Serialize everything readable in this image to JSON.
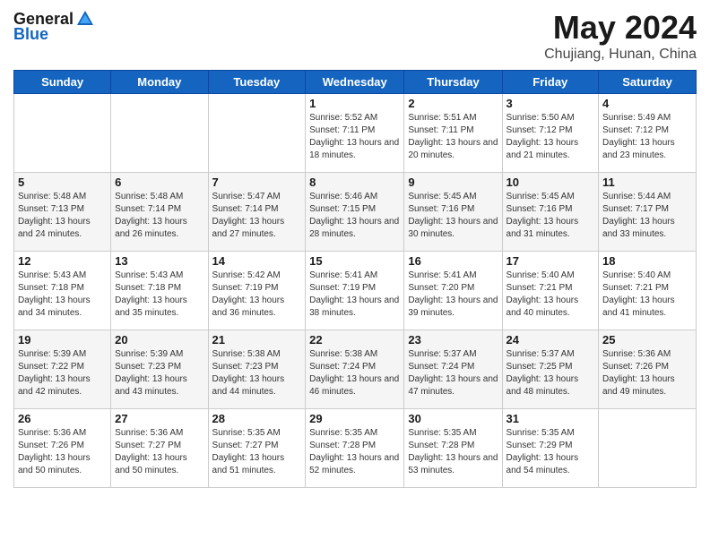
{
  "logo": {
    "general": "General",
    "blue": "Blue"
  },
  "title": {
    "month": "May 2024",
    "location": "Chujiang, Hunan, China"
  },
  "weekdays": [
    "Sunday",
    "Monday",
    "Tuesday",
    "Wednesday",
    "Thursday",
    "Friday",
    "Saturday"
  ],
  "weeks": [
    [
      {
        "day": "",
        "sunrise": "",
        "sunset": "",
        "daylight": ""
      },
      {
        "day": "",
        "sunrise": "",
        "sunset": "",
        "daylight": ""
      },
      {
        "day": "",
        "sunrise": "",
        "sunset": "",
        "daylight": ""
      },
      {
        "day": "1",
        "sunrise": "Sunrise: 5:52 AM",
        "sunset": "Sunset: 7:11 PM",
        "daylight": "Daylight: 13 hours and 18 minutes."
      },
      {
        "day": "2",
        "sunrise": "Sunrise: 5:51 AM",
        "sunset": "Sunset: 7:11 PM",
        "daylight": "Daylight: 13 hours and 20 minutes."
      },
      {
        "day": "3",
        "sunrise": "Sunrise: 5:50 AM",
        "sunset": "Sunset: 7:12 PM",
        "daylight": "Daylight: 13 hours and 21 minutes."
      },
      {
        "day": "4",
        "sunrise": "Sunrise: 5:49 AM",
        "sunset": "Sunset: 7:12 PM",
        "daylight": "Daylight: 13 hours and 23 minutes."
      }
    ],
    [
      {
        "day": "5",
        "sunrise": "Sunrise: 5:48 AM",
        "sunset": "Sunset: 7:13 PM",
        "daylight": "Daylight: 13 hours and 24 minutes."
      },
      {
        "day": "6",
        "sunrise": "Sunrise: 5:48 AM",
        "sunset": "Sunset: 7:14 PM",
        "daylight": "Daylight: 13 hours and 26 minutes."
      },
      {
        "day": "7",
        "sunrise": "Sunrise: 5:47 AM",
        "sunset": "Sunset: 7:14 PM",
        "daylight": "Daylight: 13 hours and 27 minutes."
      },
      {
        "day": "8",
        "sunrise": "Sunrise: 5:46 AM",
        "sunset": "Sunset: 7:15 PM",
        "daylight": "Daylight: 13 hours and 28 minutes."
      },
      {
        "day": "9",
        "sunrise": "Sunrise: 5:45 AM",
        "sunset": "Sunset: 7:16 PM",
        "daylight": "Daylight: 13 hours and 30 minutes."
      },
      {
        "day": "10",
        "sunrise": "Sunrise: 5:45 AM",
        "sunset": "Sunset: 7:16 PM",
        "daylight": "Daylight: 13 hours and 31 minutes."
      },
      {
        "day": "11",
        "sunrise": "Sunrise: 5:44 AM",
        "sunset": "Sunset: 7:17 PM",
        "daylight": "Daylight: 13 hours and 33 minutes."
      }
    ],
    [
      {
        "day": "12",
        "sunrise": "Sunrise: 5:43 AM",
        "sunset": "Sunset: 7:18 PM",
        "daylight": "Daylight: 13 hours and 34 minutes."
      },
      {
        "day": "13",
        "sunrise": "Sunrise: 5:43 AM",
        "sunset": "Sunset: 7:18 PM",
        "daylight": "Daylight: 13 hours and 35 minutes."
      },
      {
        "day": "14",
        "sunrise": "Sunrise: 5:42 AM",
        "sunset": "Sunset: 7:19 PM",
        "daylight": "Daylight: 13 hours and 36 minutes."
      },
      {
        "day": "15",
        "sunrise": "Sunrise: 5:41 AM",
        "sunset": "Sunset: 7:19 PM",
        "daylight": "Daylight: 13 hours and 38 minutes."
      },
      {
        "day": "16",
        "sunrise": "Sunrise: 5:41 AM",
        "sunset": "Sunset: 7:20 PM",
        "daylight": "Daylight: 13 hours and 39 minutes."
      },
      {
        "day": "17",
        "sunrise": "Sunrise: 5:40 AM",
        "sunset": "Sunset: 7:21 PM",
        "daylight": "Daylight: 13 hours and 40 minutes."
      },
      {
        "day": "18",
        "sunrise": "Sunrise: 5:40 AM",
        "sunset": "Sunset: 7:21 PM",
        "daylight": "Daylight: 13 hours and 41 minutes."
      }
    ],
    [
      {
        "day": "19",
        "sunrise": "Sunrise: 5:39 AM",
        "sunset": "Sunset: 7:22 PM",
        "daylight": "Daylight: 13 hours and 42 minutes."
      },
      {
        "day": "20",
        "sunrise": "Sunrise: 5:39 AM",
        "sunset": "Sunset: 7:23 PM",
        "daylight": "Daylight: 13 hours and 43 minutes."
      },
      {
        "day": "21",
        "sunrise": "Sunrise: 5:38 AM",
        "sunset": "Sunset: 7:23 PM",
        "daylight": "Daylight: 13 hours and 44 minutes."
      },
      {
        "day": "22",
        "sunrise": "Sunrise: 5:38 AM",
        "sunset": "Sunset: 7:24 PM",
        "daylight": "Daylight: 13 hours and 46 minutes."
      },
      {
        "day": "23",
        "sunrise": "Sunrise: 5:37 AM",
        "sunset": "Sunset: 7:24 PM",
        "daylight": "Daylight: 13 hours and 47 minutes."
      },
      {
        "day": "24",
        "sunrise": "Sunrise: 5:37 AM",
        "sunset": "Sunset: 7:25 PM",
        "daylight": "Daylight: 13 hours and 48 minutes."
      },
      {
        "day": "25",
        "sunrise": "Sunrise: 5:36 AM",
        "sunset": "Sunset: 7:26 PM",
        "daylight": "Daylight: 13 hours and 49 minutes."
      }
    ],
    [
      {
        "day": "26",
        "sunrise": "Sunrise: 5:36 AM",
        "sunset": "Sunset: 7:26 PM",
        "daylight": "Daylight: 13 hours and 50 minutes."
      },
      {
        "day": "27",
        "sunrise": "Sunrise: 5:36 AM",
        "sunset": "Sunset: 7:27 PM",
        "daylight": "Daylight: 13 hours and 50 minutes."
      },
      {
        "day": "28",
        "sunrise": "Sunrise: 5:35 AM",
        "sunset": "Sunset: 7:27 PM",
        "daylight": "Daylight: 13 hours and 51 minutes."
      },
      {
        "day": "29",
        "sunrise": "Sunrise: 5:35 AM",
        "sunset": "Sunset: 7:28 PM",
        "daylight": "Daylight: 13 hours and 52 minutes."
      },
      {
        "day": "30",
        "sunrise": "Sunrise: 5:35 AM",
        "sunset": "Sunset: 7:28 PM",
        "daylight": "Daylight: 13 hours and 53 minutes."
      },
      {
        "day": "31",
        "sunrise": "Sunrise: 5:35 AM",
        "sunset": "Sunset: 7:29 PM",
        "daylight": "Daylight: 13 hours and 54 minutes."
      },
      {
        "day": "",
        "sunrise": "",
        "sunset": "",
        "daylight": ""
      }
    ]
  ]
}
